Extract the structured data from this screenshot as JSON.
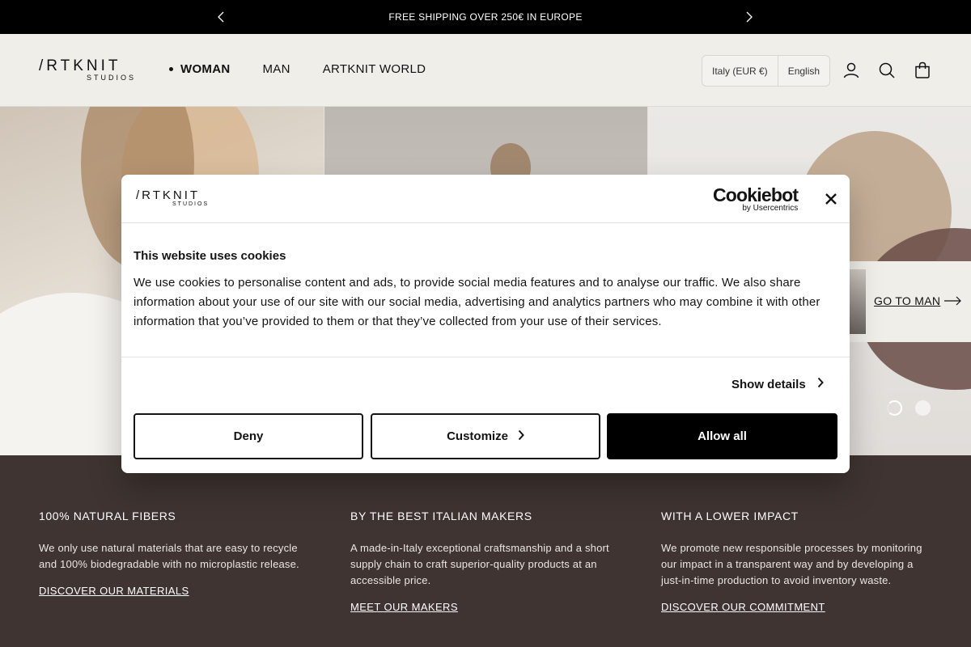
{
  "announcement": {
    "message": "FREE SHIPPING OVER 250€ IN EUROPE",
    "prev_icon": "chevron-left-icon",
    "next_icon": "chevron-right-icon"
  },
  "header": {
    "logo_word": "/RTKNIT",
    "logo_sub": "STUDIOS",
    "nav": [
      {
        "label": "WOMAN",
        "active": true
      },
      {
        "label": "MAN",
        "active": false
      },
      {
        "label": "ARTKNIT WORLD",
        "active": false
      }
    ],
    "country": "Italy (EUR €)",
    "language": "English",
    "icons": [
      "account-icon",
      "search-icon",
      "bag-icon"
    ]
  },
  "hero": {
    "goto_label": "GO TO MAN",
    "slide_count": 2,
    "active_slide": 1
  },
  "values": [
    {
      "title": "100% NATURAL FIBERS",
      "text": "We only use natural materials that are easy to recycle and 100% biodegradable with no microplastic release.",
      "link": "DISCOVER OUR MATERIALS"
    },
    {
      "title": "BY THE BEST ITALIAN MAKERS",
      "text": "A made-in-Italy exceptional craftsmanship and a short supply chain to craft superior-quality products at an accessible price.",
      "link": "MEET OUR MAKERS"
    },
    {
      "title": "WITH A LOWER IMPACT",
      "text": "We promote new responsible processes by monitoring our impact in a transparent way and by developing a just-in-time production to avoid inventory waste.",
      "link": "DISCOVER OUR COMMITMENT"
    }
  ],
  "cookie": {
    "logo_word": "/RTKNIT",
    "logo_sub": "STUDIOS",
    "brand": "Cookiebot",
    "brand_sub": "by Usercentrics",
    "title": "This website uses cookies",
    "text": "We use cookies to personalise content and ads, to provide social media features and to analyse our traffic. We also share information about your use of our site with our social media, advertising and analytics partners who may combine it with other information that you’ve provided to them or that they’ve collected from your use of their services.",
    "show_details": "Show details",
    "deny": "Deny",
    "customize": "Customize",
    "allow_all": "Allow all"
  },
  "colors": {
    "announcement_bg": "#000000",
    "header_bg": "#efeee9",
    "values_bg": "#3f3431",
    "allow_bg": "#000000"
  }
}
